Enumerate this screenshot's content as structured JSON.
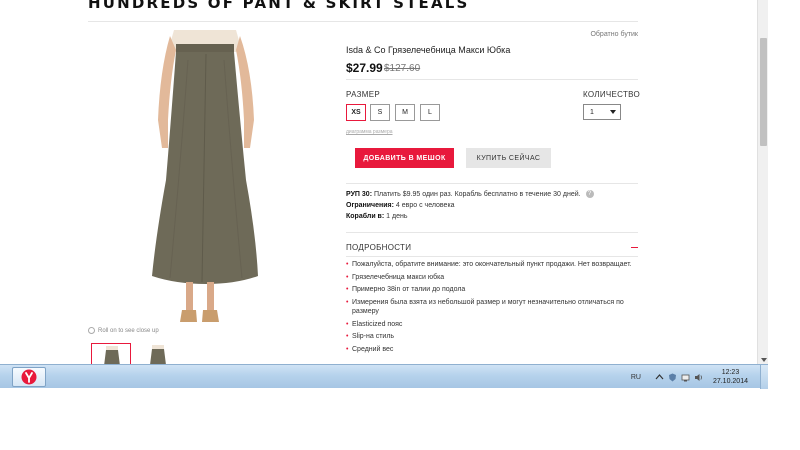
{
  "header": {
    "title": "HUNDREDS OF PANT & SKIRT STEALS",
    "back_link": "Обратно бутик"
  },
  "product": {
    "name": "Isda & Co Грязелечебница Макси Юбка",
    "price": "$27.99",
    "old_price": "$127.60",
    "zoom_hint": "Roll on to see close up",
    "image_color": "#6e6a58"
  },
  "size": {
    "label": "РАЗМЕР",
    "options": [
      "XS",
      "S",
      "M",
      "L"
    ],
    "selected": "XS",
    "chart_link": "диаграмма размера"
  },
  "quantity": {
    "label": "КОЛИЧЕСТВО",
    "value": "1"
  },
  "buttons": {
    "add_to_bag": "ДОБАВИТЬ В МЕШОК",
    "buy_now": "КУПИТЬ СЕЙЧАС"
  },
  "info": {
    "rup": {
      "label": "РУП 30:",
      "text": "Платить $9.95 один раз. Корабль бесплатно в течение 30 дней."
    },
    "limits": {
      "label": "Ограничения:",
      "text": "4 евро с человека"
    },
    "ships": {
      "label": "Корабли в:",
      "text": "1 день"
    }
  },
  "details": {
    "title": "ПОДРОБНОСТИ",
    "items": [
      "Пожалуйста, обратите внимание: это окончательный пункт продажи. Нет возвращает.",
      "Грязелечебница макси юбка",
      "Примерно 38in от талии до подола",
      "Измерения была взята из небольшой размер и могут незначительно отличаться по размеру",
      "Elasticized пояс",
      "Slip-на стиль",
      "Средний вес"
    ]
  },
  "taskbar": {
    "lang": "RU",
    "time": "12:23",
    "date": "27.10.2014"
  },
  "colors": {
    "accent": "#e8193c",
    "taskbar": "#b6d2ec"
  }
}
